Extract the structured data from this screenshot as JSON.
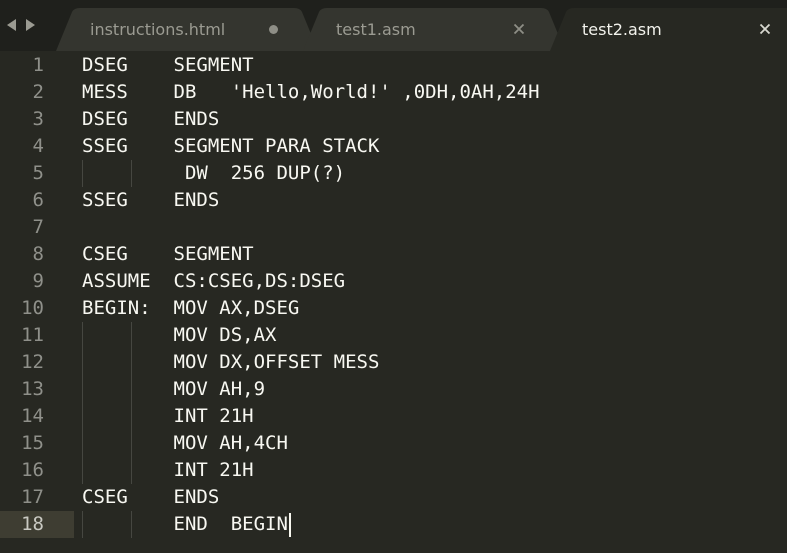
{
  "tabbar": {
    "back_icon": "chevron-left-icon",
    "forward_icon": "chevron-right-icon",
    "tabs": [
      {
        "label": "instructions.html",
        "state": "modified",
        "active": false
      },
      {
        "label": "test1.asm",
        "state": "close",
        "active": false
      },
      {
        "label": "test2.asm",
        "state": "close",
        "active": true
      }
    ]
  },
  "editor": {
    "current_line": 18,
    "lines": [
      {
        "number": "1",
        "text": "DSEG    SEGMENT"
      },
      {
        "number": "2",
        "text": "MESS    DB   'Hello,World!' ,0DH,0AH,24H"
      },
      {
        "number": "3",
        "text": "DSEG    ENDS"
      },
      {
        "number": "4",
        "text": "SSEG    SEGMENT PARA STACK"
      },
      {
        "number": "5",
        "text": "         DW  256 DUP(?)"
      },
      {
        "number": "6",
        "text": "SSEG    ENDS"
      },
      {
        "number": "7",
        "text": ""
      },
      {
        "number": "8",
        "text": "CSEG    SEGMENT"
      },
      {
        "number": "9",
        "text": "ASSUME  CS:CSEG,DS:DSEG"
      },
      {
        "number": "10",
        "text": "BEGIN:  MOV AX,DSEG"
      },
      {
        "number": "11",
        "text": "        MOV DS,AX"
      },
      {
        "number": "12",
        "text": "        MOV DX,OFFSET MESS"
      },
      {
        "number": "13",
        "text": "        MOV AH,9"
      },
      {
        "number": "14",
        "text": "        INT 21H"
      },
      {
        "number": "15",
        "text": "        MOV AH,4CH"
      },
      {
        "number": "16",
        "text": "        INT 21H"
      },
      {
        "number": "17",
        "text": "CSEG    ENDS"
      },
      {
        "number": "18",
        "text": "        END  BEGIN"
      }
    ]
  },
  "colors": {
    "editor_bg": "#272822",
    "tabbar_bg": "#1f201c",
    "active_tab_bg": "#272822",
    "inactive_tab_bg": "#34352f",
    "text": "#f8f8f2",
    "line_number": "#8f908a",
    "current_line": "#3e3d32"
  }
}
